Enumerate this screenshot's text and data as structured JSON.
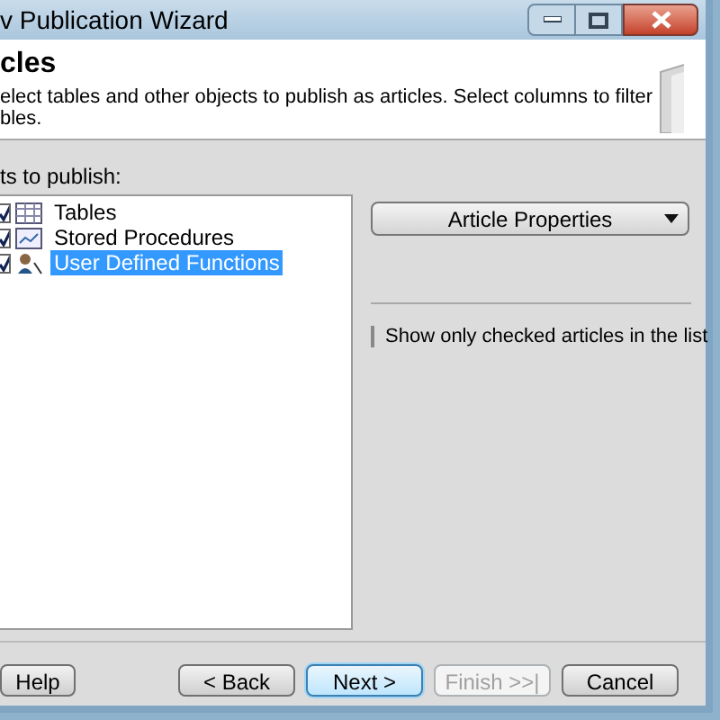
{
  "window": {
    "title": "v Publication Wizard"
  },
  "header": {
    "title": "cles",
    "description_lines": [
      "elect tables and other objects to publish as articles. Select columns to filter",
      "bles."
    ]
  },
  "objects_label": "ts to publish:",
  "objects": [
    {
      "label": "Tables",
      "kind": "table",
      "checked": true,
      "selected": false
    },
    {
      "label": "Stored Procedures",
      "kind": "procedure",
      "checked": true,
      "selected": false
    },
    {
      "label": "User Defined Functions",
      "kind": "function",
      "checked": true,
      "selected": true
    }
  ],
  "article_properties_button": "Article Properties",
  "show_checked_only": {
    "label": "Show only checked articles in the list",
    "checked": false
  },
  "buttons": [
    {
      "label": "Help",
      "kind": "normal"
    },
    {
      "label": "< Back",
      "kind": "normal"
    },
    {
      "label": "Next >",
      "kind": "default"
    },
    {
      "label": "Finish >>|",
      "kind": "disabled"
    },
    {
      "label": "Cancel",
      "kind": "normal"
    }
  ]
}
